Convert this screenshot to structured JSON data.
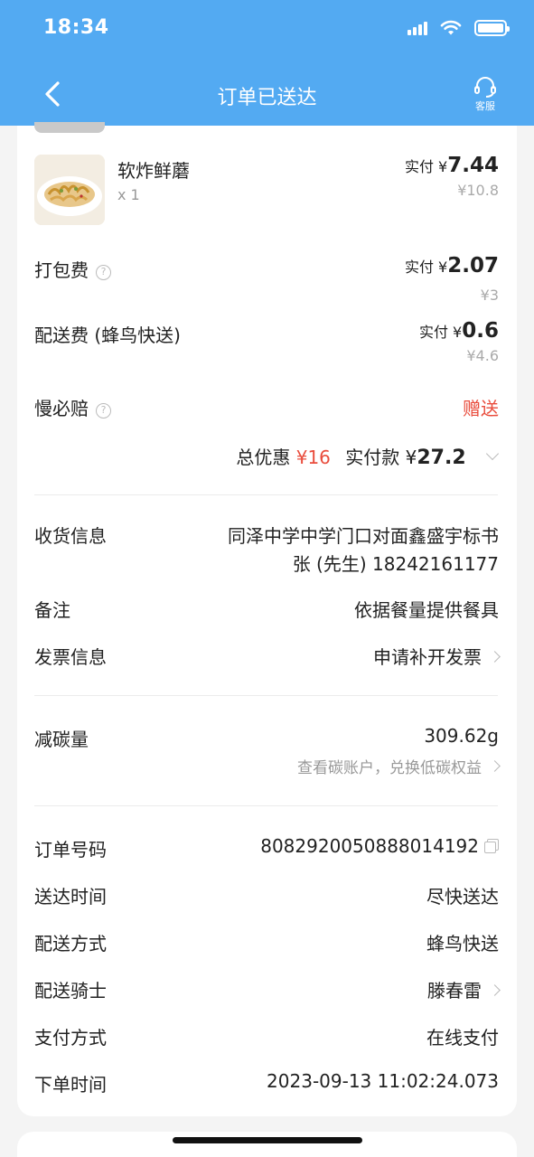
{
  "status_bar": {
    "time": "18:34"
  },
  "header": {
    "title": "订单已送达",
    "service_label": "客服"
  },
  "item": {
    "name": "软炸鲜蘑",
    "qty": "x 1",
    "paid_label": "实付 ¥",
    "paid_amount": "7.44",
    "original": "¥10.8"
  },
  "fees": [
    {
      "label": "打包费",
      "paid_label": "实付 ¥",
      "paid_amount": "2.07",
      "original": "¥3"
    },
    {
      "label": "配送费 (蜂鸟快送)",
      "paid_label": "实付 ¥",
      "paid_amount": "0.6",
      "original": "¥4.6"
    }
  ],
  "guarantee": {
    "label": "慢必赔",
    "value": "赠送"
  },
  "summary": {
    "discount_label": "总优惠",
    "discount_value": "¥16",
    "paid_label": "实付款 ¥",
    "paid_value": "27.2"
  },
  "delivery_info": {
    "address_label": "收货信息",
    "address_line1": "同泽中学中学门口对面鑫盛宇标书",
    "address_line2": "张 (先生) 18242161177",
    "note_label": "备注",
    "note_value": "依据餐量提供餐具",
    "invoice_label": "发票信息",
    "invoice_value": "申请补开发票"
  },
  "carbon": {
    "label": "减碳量",
    "value": "309.62g",
    "link": "查看碳账户，兑换低碳权益"
  },
  "order": {
    "number_label": "订单号码",
    "number_value": "8082920050888014192",
    "time_label": "送达时间",
    "time_value": "尽快送达",
    "method_label": "配送方式",
    "method_value": "蜂鸟快送",
    "rider_label": "配送骑士",
    "rider_value": "滕春雷",
    "pay_label": "支付方式",
    "pay_value": "在线支付",
    "created_label": "下单时间",
    "created_value": "2023-09-13 11:02:24.073"
  },
  "colors": {
    "header_bg": "#53aaf2",
    "accent_red": "#e94c3c"
  }
}
